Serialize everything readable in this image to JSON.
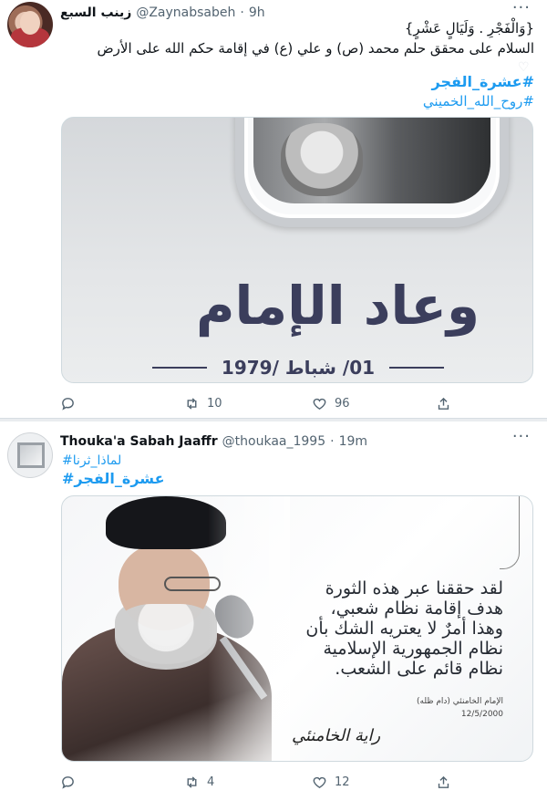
{
  "tweets": [
    {
      "author_name": "زينب السبع",
      "handle": "@Zaynabsabeh",
      "separator_dot": "·",
      "time": "9h",
      "more": "···",
      "lines": [
        "{وَالْفَجْرِ . وَلَيَالٍ عَشْرٍ}",
        "السلام على محقق حلم محمد (ص) و علي (ع) في إقامة حكم الله على الأرض"
      ],
      "hashtags": [
        "#عشرة_الفجر",
        "#روح_الله_الخميني"
      ],
      "media": {
        "title": "وعاد الإمام",
        "date": "01/ شباط /1979"
      },
      "actions": {
        "reply_count": "",
        "retweet_count": "10",
        "like_count": "96"
      }
    },
    {
      "author_name": "Thouka'a Sabah Jaaffr",
      "handle": "@thoukaa_1995",
      "separator_dot": "·",
      "time": "19m",
      "more": "···",
      "hashtags": [
        "#لماذا_ثرنا",
        "#عشرة_الفجر"
      ],
      "media": {
        "quote_lines": [
          "لقد حققنا عبر هذه الثورة",
          "هدف إقامة نظام شعبي،",
          "وهذا أمرٌ لا يعتريه الشك بأن",
          "نظام الجمهورية الإسلامية",
          "نظام قائم على الشعب."
        ],
        "attribution": "الإمام الخامنئي (دام ظله)",
        "attribution_date": "12/5/2000",
        "signature": "راية الخامنئي"
      },
      "actions": {
        "reply_count": "",
        "retweet_count": "4",
        "like_count": "12"
      }
    }
  ],
  "colors": {
    "accent": "#1d9bf0",
    "muted": "#536471",
    "text": "#0f1419"
  }
}
